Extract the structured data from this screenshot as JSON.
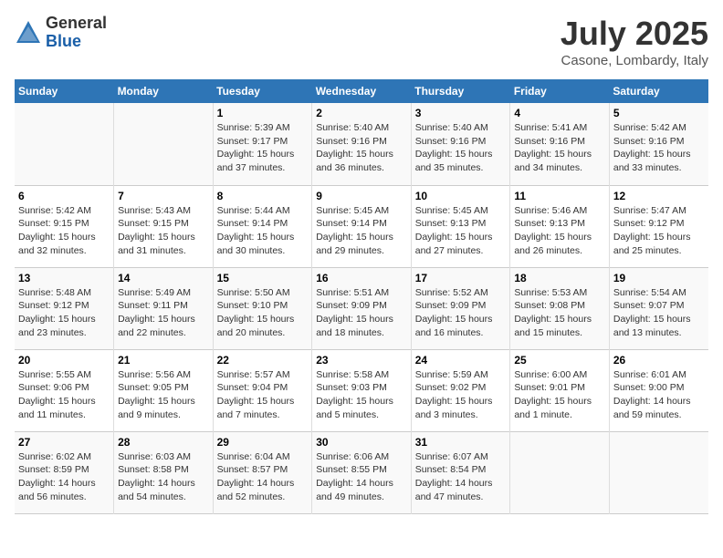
{
  "header": {
    "logo_general": "General",
    "logo_blue": "Blue",
    "month_title": "July 2025",
    "location": "Casone, Lombardy, Italy"
  },
  "days_of_week": [
    "Sunday",
    "Monday",
    "Tuesday",
    "Wednesday",
    "Thursday",
    "Friday",
    "Saturday"
  ],
  "weeks": [
    [
      {
        "day": "",
        "info": ""
      },
      {
        "day": "",
        "info": ""
      },
      {
        "day": "1",
        "info": "Sunrise: 5:39 AM\nSunset: 9:17 PM\nDaylight: 15 hours\nand 37 minutes."
      },
      {
        "day": "2",
        "info": "Sunrise: 5:40 AM\nSunset: 9:16 PM\nDaylight: 15 hours\nand 36 minutes."
      },
      {
        "day": "3",
        "info": "Sunrise: 5:40 AM\nSunset: 9:16 PM\nDaylight: 15 hours\nand 35 minutes."
      },
      {
        "day": "4",
        "info": "Sunrise: 5:41 AM\nSunset: 9:16 PM\nDaylight: 15 hours\nand 34 minutes."
      },
      {
        "day": "5",
        "info": "Sunrise: 5:42 AM\nSunset: 9:16 PM\nDaylight: 15 hours\nand 33 minutes."
      }
    ],
    [
      {
        "day": "6",
        "info": "Sunrise: 5:42 AM\nSunset: 9:15 PM\nDaylight: 15 hours\nand 32 minutes."
      },
      {
        "day": "7",
        "info": "Sunrise: 5:43 AM\nSunset: 9:15 PM\nDaylight: 15 hours\nand 31 minutes."
      },
      {
        "day": "8",
        "info": "Sunrise: 5:44 AM\nSunset: 9:14 PM\nDaylight: 15 hours\nand 30 minutes."
      },
      {
        "day": "9",
        "info": "Sunrise: 5:45 AM\nSunset: 9:14 PM\nDaylight: 15 hours\nand 29 minutes."
      },
      {
        "day": "10",
        "info": "Sunrise: 5:45 AM\nSunset: 9:13 PM\nDaylight: 15 hours\nand 27 minutes."
      },
      {
        "day": "11",
        "info": "Sunrise: 5:46 AM\nSunset: 9:13 PM\nDaylight: 15 hours\nand 26 minutes."
      },
      {
        "day": "12",
        "info": "Sunrise: 5:47 AM\nSunset: 9:12 PM\nDaylight: 15 hours\nand 25 minutes."
      }
    ],
    [
      {
        "day": "13",
        "info": "Sunrise: 5:48 AM\nSunset: 9:12 PM\nDaylight: 15 hours\nand 23 minutes."
      },
      {
        "day": "14",
        "info": "Sunrise: 5:49 AM\nSunset: 9:11 PM\nDaylight: 15 hours\nand 22 minutes."
      },
      {
        "day": "15",
        "info": "Sunrise: 5:50 AM\nSunset: 9:10 PM\nDaylight: 15 hours\nand 20 minutes."
      },
      {
        "day": "16",
        "info": "Sunrise: 5:51 AM\nSunset: 9:09 PM\nDaylight: 15 hours\nand 18 minutes."
      },
      {
        "day": "17",
        "info": "Sunrise: 5:52 AM\nSunset: 9:09 PM\nDaylight: 15 hours\nand 16 minutes."
      },
      {
        "day": "18",
        "info": "Sunrise: 5:53 AM\nSunset: 9:08 PM\nDaylight: 15 hours\nand 15 minutes."
      },
      {
        "day": "19",
        "info": "Sunrise: 5:54 AM\nSunset: 9:07 PM\nDaylight: 15 hours\nand 13 minutes."
      }
    ],
    [
      {
        "day": "20",
        "info": "Sunrise: 5:55 AM\nSunset: 9:06 PM\nDaylight: 15 hours\nand 11 minutes."
      },
      {
        "day": "21",
        "info": "Sunrise: 5:56 AM\nSunset: 9:05 PM\nDaylight: 15 hours\nand 9 minutes."
      },
      {
        "day": "22",
        "info": "Sunrise: 5:57 AM\nSunset: 9:04 PM\nDaylight: 15 hours\nand 7 minutes."
      },
      {
        "day": "23",
        "info": "Sunrise: 5:58 AM\nSunset: 9:03 PM\nDaylight: 15 hours\nand 5 minutes."
      },
      {
        "day": "24",
        "info": "Sunrise: 5:59 AM\nSunset: 9:02 PM\nDaylight: 15 hours\nand 3 minutes."
      },
      {
        "day": "25",
        "info": "Sunrise: 6:00 AM\nSunset: 9:01 PM\nDaylight: 15 hours\nand 1 minute."
      },
      {
        "day": "26",
        "info": "Sunrise: 6:01 AM\nSunset: 9:00 PM\nDaylight: 14 hours\nand 59 minutes."
      }
    ],
    [
      {
        "day": "27",
        "info": "Sunrise: 6:02 AM\nSunset: 8:59 PM\nDaylight: 14 hours\nand 56 minutes."
      },
      {
        "day": "28",
        "info": "Sunrise: 6:03 AM\nSunset: 8:58 PM\nDaylight: 14 hours\nand 54 minutes."
      },
      {
        "day": "29",
        "info": "Sunrise: 6:04 AM\nSunset: 8:57 PM\nDaylight: 14 hours\nand 52 minutes."
      },
      {
        "day": "30",
        "info": "Sunrise: 6:06 AM\nSunset: 8:55 PM\nDaylight: 14 hours\nand 49 minutes."
      },
      {
        "day": "31",
        "info": "Sunrise: 6:07 AM\nSunset: 8:54 PM\nDaylight: 14 hours\nand 47 minutes."
      },
      {
        "day": "",
        "info": ""
      },
      {
        "day": "",
        "info": ""
      }
    ]
  ]
}
